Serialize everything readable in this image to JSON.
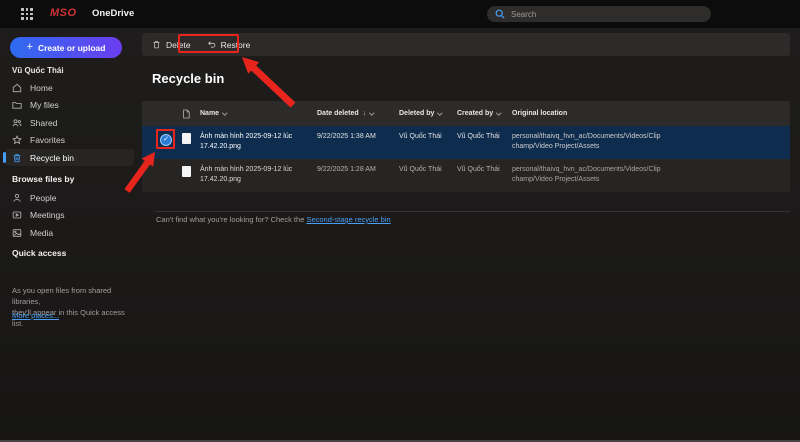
{
  "colors": {
    "accent_blue": "#479ef5",
    "annotation_red": "#e8251d",
    "selected_row": "#0e2c4e",
    "link_blue": "#4a9ef5",
    "logo_red": "#d13438",
    "grad_start": "#2f6bf0",
    "grad_end": "#6b3df0"
  },
  "icons": {
    "plus": "+",
    "check": "✓",
    "sort_desc": "↓"
  },
  "topbar": {
    "logo_text": "MSO",
    "app_name": "OneDrive",
    "search_placeholder": "Search"
  },
  "sidebar": {
    "create_button": "Create or upload",
    "user_name": "Vũ Quốc Thái",
    "nav": [
      {
        "label": "Home"
      },
      {
        "label": "My files"
      },
      {
        "label": "Shared"
      },
      {
        "label": "Favorites"
      },
      {
        "label": "Recycle bin"
      }
    ],
    "browse_header": "Browse files by",
    "browse": [
      {
        "label": "People"
      },
      {
        "label": "Meetings"
      },
      {
        "label": "Media"
      }
    ],
    "quick_access_header": "Quick access",
    "quick_access_line1": "As you open files from shared libraries,",
    "quick_access_line2": "they'll appear in this Quick access list.",
    "more_places": "More places..."
  },
  "toolbar": {
    "delete_label": "Delete",
    "restore_label": "Restore"
  },
  "main": {
    "title": "Recycle bin",
    "table": {
      "columns": [
        "Name",
        "Date deleted",
        "Deleted by",
        "Created by",
        "Original location"
      ],
      "rows": [
        {
          "name_line1": "Ảnh màn hình 2025-09-12 lúc",
          "name_line2": "17.42.20.png",
          "date_deleted": "9/22/2025 1:38 AM",
          "deleted_by": "Vũ Quốc Thái",
          "created_by": "Vũ Quốc Thái",
          "location_line1": "personal/thaivq_hvn_ac/Documents/Videos/Clip",
          "location_line2": "champ/Video Project/Assets"
        },
        {
          "name_line1": "Ảnh màn hình 2025-09-12 lúc",
          "name_line2": "17.42.20.png",
          "date_deleted": "9/22/2025 1:28 AM",
          "deleted_by": "Vũ Quốc Thái",
          "created_by": "Vũ Quốc Thái",
          "location_line1": "personal/thaivq_hvn_ac/Documents/Videos/Clip",
          "location_line2": "champ/Video Project/Assets"
        }
      ]
    },
    "footer_text": "Can't find what you're looking for? Check the ",
    "footer_link": "Second-stage recycle bin"
  }
}
